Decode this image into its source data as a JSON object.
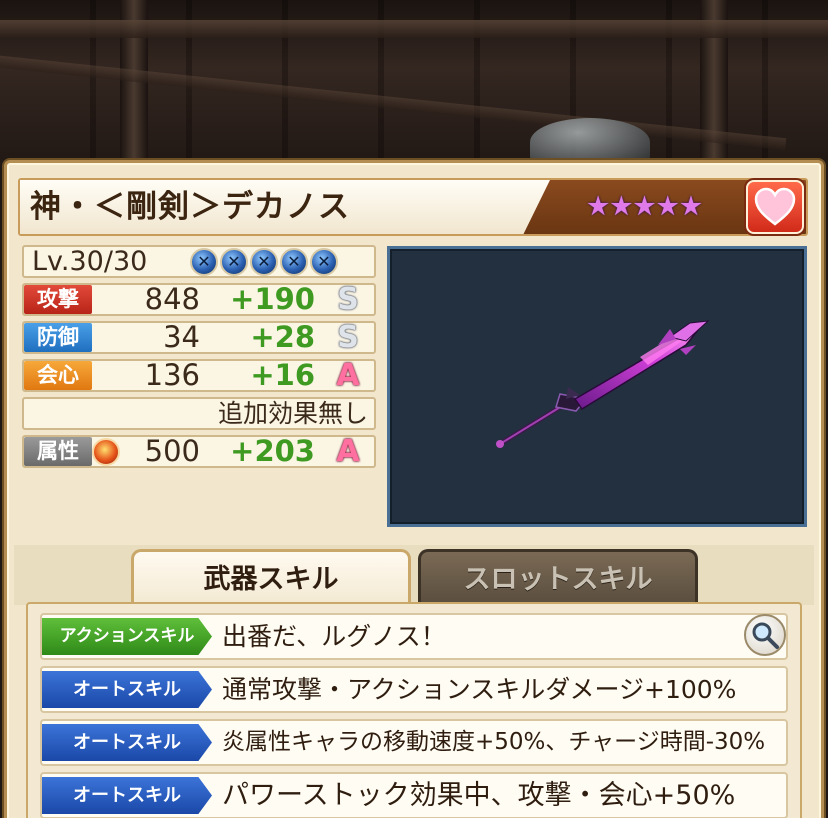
{
  "weapon": {
    "name": "神・＜剛剣＞デカノス",
    "rarity": "★★★★★",
    "level": "Lv.30/30",
    "limit_break_orbs": 5
  },
  "stats": {
    "attack": {
      "label": "攻撃",
      "base": "848",
      "bonus": "+190",
      "grade": "S"
    },
    "defense": {
      "label": "防御",
      "base": "34",
      "bonus": "+28",
      "grade": "S"
    },
    "critical": {
      "label": "会心",
      "base": "136",
      "bonus": "+16",
      "grade": "A"
    },
    "extra_effect": "追加効果無し",
    "element": {
      "label": "属性",
      "icon": "fire-element-icon",
      "base": "500",
      "bonus": "+203",
      "grade": "A"
    }
  },
  "tabs": [
    {
      "label": "武器スキル",
      "active": true
    },
    {
      "label": "スロットスキル",
      "active": false
    }
  ],
  "skills": [
    {
      "type": "アクションスキル",
      "description": "出番だ、ルグノス！"
    },
    {
      "type": "オートスキル",
      "description": "通常攻撃・アクションスキルダメージ+100%"
    },
    {
      "type": "オートスキル",
      "description": "炎属性キャラの移動速度+50%、チャージ時間-30%"
    },
    {
      "type": "オートスキル",
      "description": "パワーストック効果中、攻撃・会心+50%"
    }
  ],
  "colors": {
    "bonus_green": "#3f9a22",
    "grade_a_pink": "#ff6fa0",
    "rarity_star": "#e07ae8",
    "action_skill": "#2f8a18",
    "auto_skill": "#1a48a8"
  }
}
